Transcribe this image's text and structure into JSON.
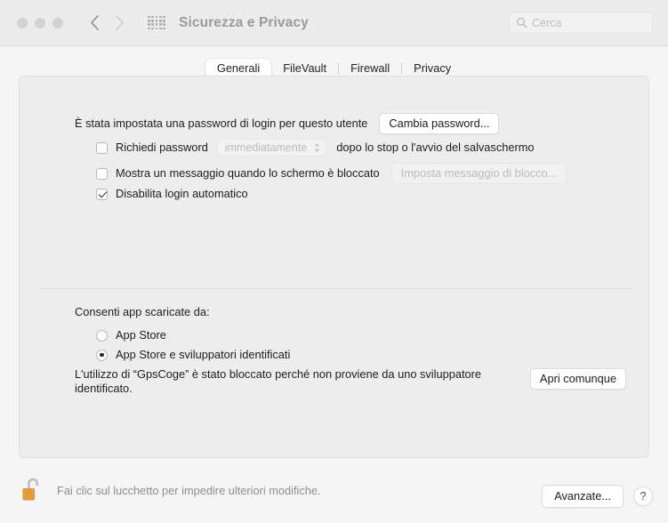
{
  "window": {
    "title": "Sicurezza e Privacy",
    "traffic_lights": [
      "close-button",
      "minimize-button",
      "zoom-button"
    ],
    "nav": {
      "back": "back-chevron",
      "forward": "forward-chevron"
    },
    "grid_icon": "show-all-grid-icon"
  },
  "search": {
    "placeholder": "Cerca",
    "value": "",
    "icon": "search-icon"
  },
  "tabs": [
    {
      "label": "Generali",
      "selected": true
    },
    {
      "label": "FileVault",
      "selected": false
    },
    {
      "label": "Firewall",
      "selected": false
    },
    {
      "label": "Privacy",
      "selected": false
    }
  ],
  "general": {
    "password_status": "È stata impostata una password di login per questo utente",
    "change_password_button": "Cambia password...",
    "require_password": {
      "label": "Richiedi password",
      "checked": false,
      "popup_value": "immediatamente",
      "suffix": "dopo lo stop o l'avvio del salvaschermo"
    },
    "show_message": {
      "label": "Mostra un messaggio quando lo schermo è bloccato",
      "checked": false,
      "button": "Imposta messaggio di blocco...",
      "button_disabled": true
    },
    "disable_autologin": {
      "label": "Disabilita login automatico",
      "checked": true
    }
  },
  "downloads": {
    "heading": "Consenti app scaricate da:",
    "options": [
      {
        "label": "App Store",
        "selected": false
      },
      {
        "label": "App Store e sviluppatori identificati",
        "selected": true
      }
    ],
    "blocked_message": "L'utilizzo di “GpsCoge” è stato bloccato perché non proviene da uno sviluppatore identificato.",
    "blocked_app_name": "GpsCoge",
    "open_anyway_button": "Apri comunque"
  },
  "bottom": {
    "lock_icon": "unlocked-padlock-icon",
    "lock_text": "Fai clic sul lucchetto per impedire ulteriori modifiche.",
    "advanced_button": "Avanzate...",
    "help_button": "?"
  },
  "colors": {
    "window_bg": "#f5f5f5",
    "titlebar_bg": "#ececec",
    "panel_bg": "#ededed",
    "lock_gold": "#e8a33d",
    "text": "#1d1d1d",
    "muted_text": "#8e8e8e"
  }
}
